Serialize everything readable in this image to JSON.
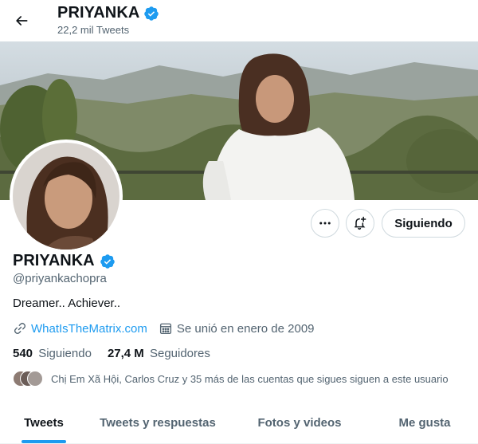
{
  "header": {
    "name": "PRIYANKA",
    "tweet_count": "22,2 mil Tweets"
  },
  "profile": {
    "name": "PRIYANKA",
    "handle": "@priyankachopra",
    "bio": "Dreamer.. Achiever..",
    "website": "WhatIsTheMatrix.com",
    "joined": "Se unió en enero de 2009",
    "following_count": "540",
    "following_label": "Siguiendo",
    "followers_count": "27,4 M",
    "followers_label": "Seguidores",
    "followers_you_know": "Chị Em Xã Hội, Carlos Cruz y 35 más de las cuentas que sigues siguen a este usuario"
  },
  "actions": {
    "following_button": "Siguiendo"
  },
  "tabs": [
    {
      "label": "Tweets",
      "active": true
    },
    {
      "label": "Tweets y respuestas",
      "active": false
    },
    {
      "label": "Fotos y videos",
      "active": false
    },
    {
      "label": "Me gusta",
      "active": false
    }
  ],
  "colors": {
    "accent": "#1d9bf0",
    "verified": "#1d9bf0",
    "secondary_text": "#536471"
  },
  "icons": [
    "back-arrow-icon",
    "verified-badge-icon",
    "more-icon",
    "notification-bell-icon",
    "link-icon",
    "calendar-icon"
  ]
}
